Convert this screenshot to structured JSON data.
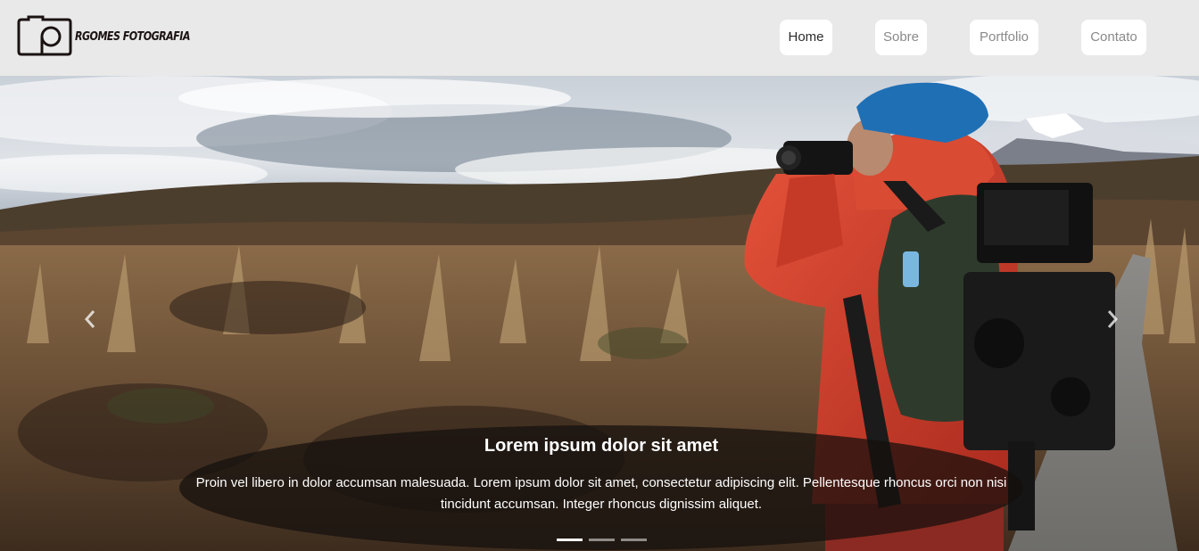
{
  "header": {
    "brand": {
      "logo_icon": "camera-outline-icon",
      "name": "RGOMES FOTOGRAFIA"
    },
    "nav": [
      {
        "label": "Home",
        "active": true
      },
      {
        "label": "Sobre",
        "active": false
      },
      {
        "label": "Portfolio",
        "active": false
      },
      {
        "label": "Contato",
        "active": false
      }
    ]
  },
  "carousel": {
    "prev_icon": "chevron-left-icon",
    "next_icon": "chevron-right-icon",
    "slide": {
      "image": "photographer-in-red-jacket-on-moorland-path",
      "title": "Lorem ipsum dolor sit amet",
      "text": "Proin vel libero in dolor accumsan malesuada. Lorem ipsum dolor sit amet, consectetur adipiscing elit. Pellentesque rhoncus orci non nisi tincidunt accumsan. Integer rhoncus dignissim aliquet."
    },
    "indicators": [
      {
        "active": true
      },
      {
        "active": false
      },
      {
        "active": false
      }
    ]
  },
  "colors": {
    "header_bg": "#e9e9e9",
    "nav_pill_bg": "#ffffff",
    "nav_active_text": "#2b2b2b",
    "nav_text": "#8a8a8a",
    "jacket": "#d9412a",
    "beanie": "#1f6fb5"
  }
}
